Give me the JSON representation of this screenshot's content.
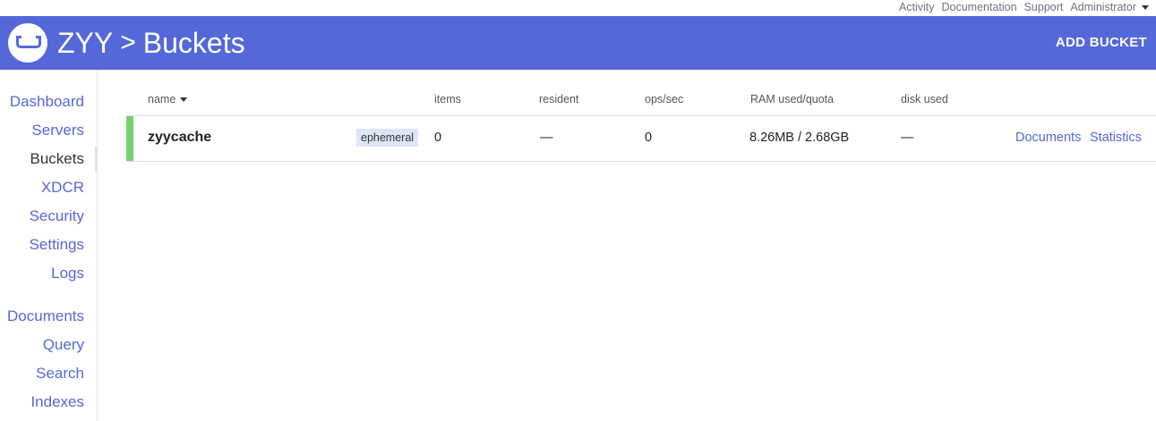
{
  "topbar": {
    "links": [
      "Activity",
      "Documentation",
      "Support",
      "Administrator"
    ]
  },
  "header": {
    "cluster": "ZYY",
    "separator": ">",
    "page": "Buckets",
    "add_bucket_label": "ADD BUCKET",
    "logo_icon": "bucket-logo-icon"
  },
  "sidebar": {
    "groups": [
      [
        "Dashboard",
        "Servers",
        "Buckets",
        "XDCR",
        "Security",
        "Settings",
        "Logs"
      ],
      [
        "Documents",
        "Query",
        "Search",
        "Indexes"
      ]
    ],
    "active": "Buckets"
  },
  "table": {
    "columns": [
      "name",
      "items",
      "resident",
      "ops/sec",
      "RAM used/quota",
      "disk used"
    ],
    "rows": [
      {
        "name": "zyycache",
        "type": "ephemeral",
        "items": "0",
        "resident": "—",
        "ops_sec": "0",
        "ram": "8.26MB / 2.68GB",
        "disk": "—",
        "actions": [
          "Documents",
          "Statistics"
        ]
      }
    ]
  },
  "colors": {
    "brand": "#5468da",
    "status_healthy": "#73d36f",
    "tag_bg": "#dde6f7"
  }
}
